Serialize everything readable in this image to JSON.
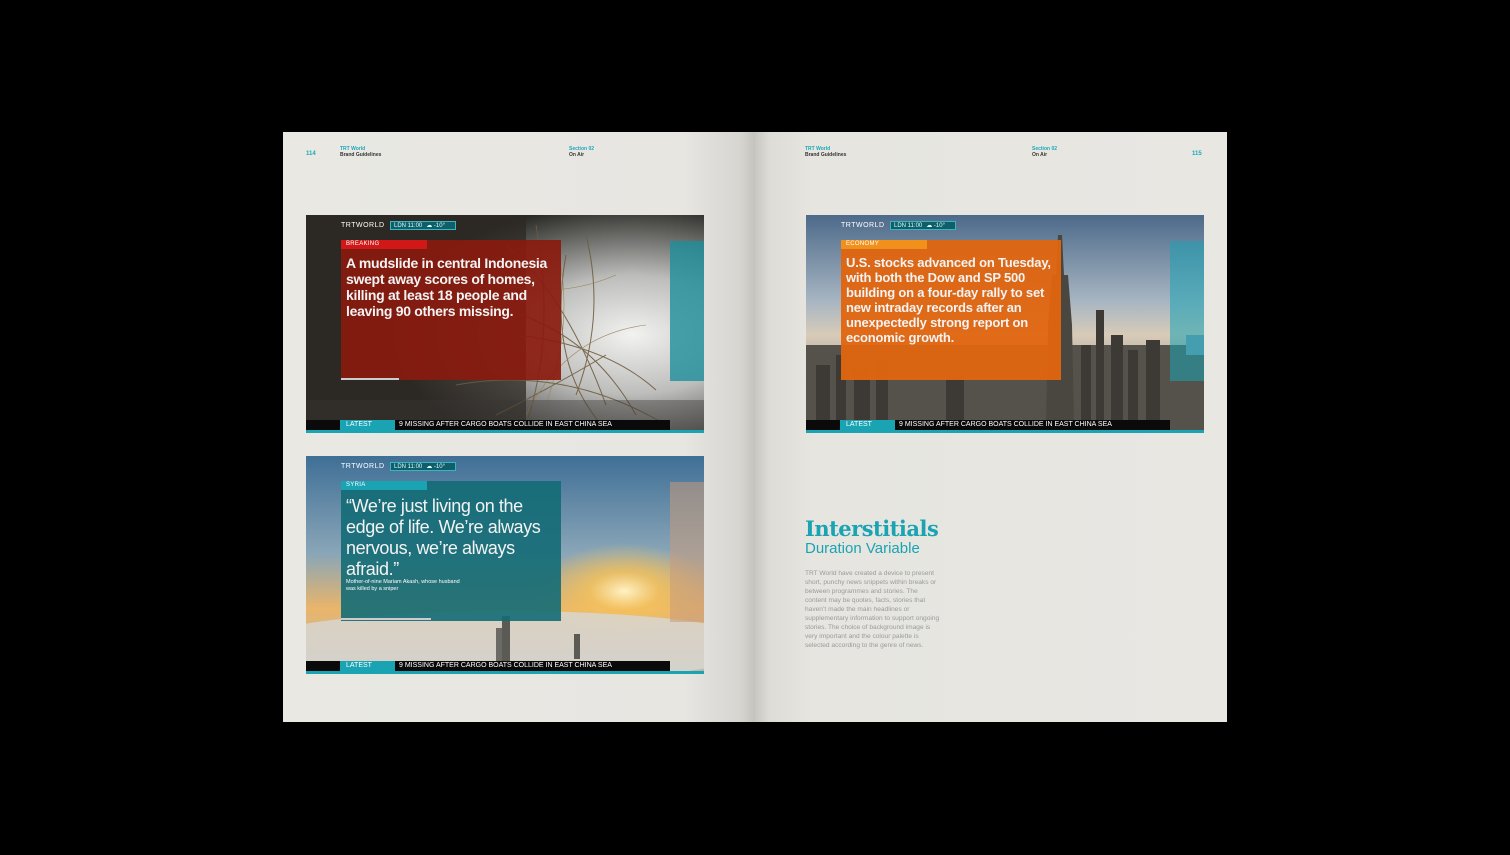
{
  "left_page": {
    "number": "114",
    "header_title": "TRT World",
    "header_sub": "Brand Guidelines",
    "section_title": "Section 02",
    "section_sub": "On Air"
  },
  "right_page": {
    "number": "115",
    "header_title": "TRT World",
    "header_sub": "Brand Guidelines",
    "section_title": "Section 02",
    "section_sub": "On Air"
  },
  "cards": [
    {
      "logo": "TRTWORLD",
      "time": "LDN 11:00",
      "temp": "-10°",
      "category": "BREAKING",
      "headline": "A mudslide in central Indonesia swept away scores of homes, killing at least 18 people and leaving 90 others missing.",
      "latest": "LATEST",
      "ticker": "9 MISSING AFTER CARGO BOATS COLLIDE IN EAST CHINA SEA"
    },
    {
      "logo": "TRTWORLD",
      "time": "LDN 11:00",
      "temp": "-10°",
      "category": "SYRIA",
      "headline": "“We’re just living on the edge of life. We’re always nervous, we’re always afraid.”",
      "caption": "Mother-of-nine Mariam Akash, whose husband was killed by a sniper",
      "latest": "LATEST",
      "ticker": "9 MISSING AFTER CARGO BOATS COLLIDE IN EAST CHINA SEA"
    },
    {
      "logo": "TRTWORLD",
      "time": "LDN 11:00",
      "temp": "-10°",
      "category": "ECONOMY",
      "headline": "U.S. stocks advanced on Tuesday, with both the Dow and SP 500 building on a four-day rally to set new intraday records after an unexpectedly strong report on economic growth.",
      "latest": "LATEST",
      "ticker": "9 MISSING AFTER CARGO BOATS COLLIDE IN EAST CHINA SEA"
    }
  ],
  "interstitials": {
    "title": "Interstitials",
    "subtitle": "Duration Variable",
    "body": "TRT World have created a device to present short, punchy news snippets within breaks or between programmes and stories. The content may be quotes, facts, stories that haven’t made the main headlines or supplementary information to support ongoing stories. The choice of background image is very important and the colour palette is selected according to the genre of news."
  },
  "colors": {
    "accent": "#1aa3b3",
    "breaking": "#8a1a0e",
    "economy": "#e0650f",
    "syria": "#136b76"
  }
}
